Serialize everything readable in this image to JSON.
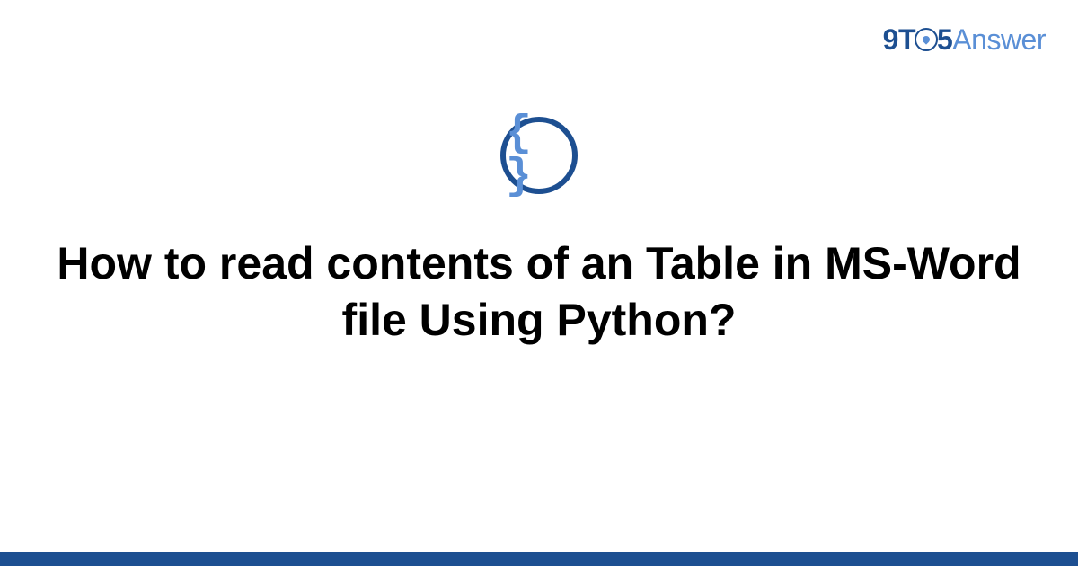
{
  "logo": {
    "nine": "9",
    "t": "T",
    "five": "5",
    "answer": "Answer"
  },
  "icon": {
    "braces": "{ }"
  },
  "title": "How to read contents of an Table in MS-Word file Using Python?",
  "colors": {
    "primary": "#1d4f91",
    "accent": "#5a8fd6"
  }
}
